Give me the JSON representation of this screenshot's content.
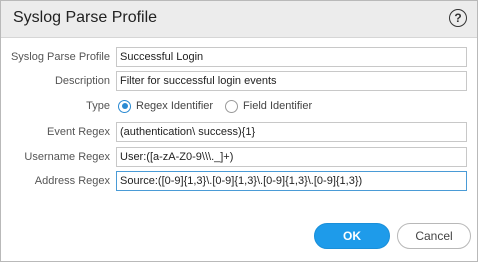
{
  "dialog": {
    "title": "Syslog Parse Profile",
    "help_icon": "question-circle-icon",
    "help_glyph": "?"
  },
  "form": {
    "profile": {
      "label": "Syslog Parse Profile",
      "value": "Successful Login"
    },
    "description": {
      "label": "Description",
      "value": "Filter for successful login events"
    },
    "type": {
      "label": "Type",
      "options": [
        {
          "label": "Regex Identifier",
          "selected": true
        },
        {
          "label": "Field Identifier",
          "selected": false
        }
      ]
    },
    "event_regex": {
      "label": "Event Regex",
      "value": "(authentication\\ success){1}"
    },
    "username_regex": {
      "label": "Username Regex",
      "value": "User:([a-zA-Z0-9\\\\\\._]+)"
    },
    "address_regex": {
      "label": "Address Regex",
      "value": "Source:([0-9]{1,3}\\.[0-9]{1,3}\\.[0-9]{1,3}\\.[0-9]{1,3})"
    }
  },
  "buttons": {
    "ok": "OK",
    "cancel": "Cancel"
  },
  "colors": {
    "accent": "#1e9bea",
    "titlebar": "#ececec",
    "focus_border": "#4a9bd6"
  }
}
